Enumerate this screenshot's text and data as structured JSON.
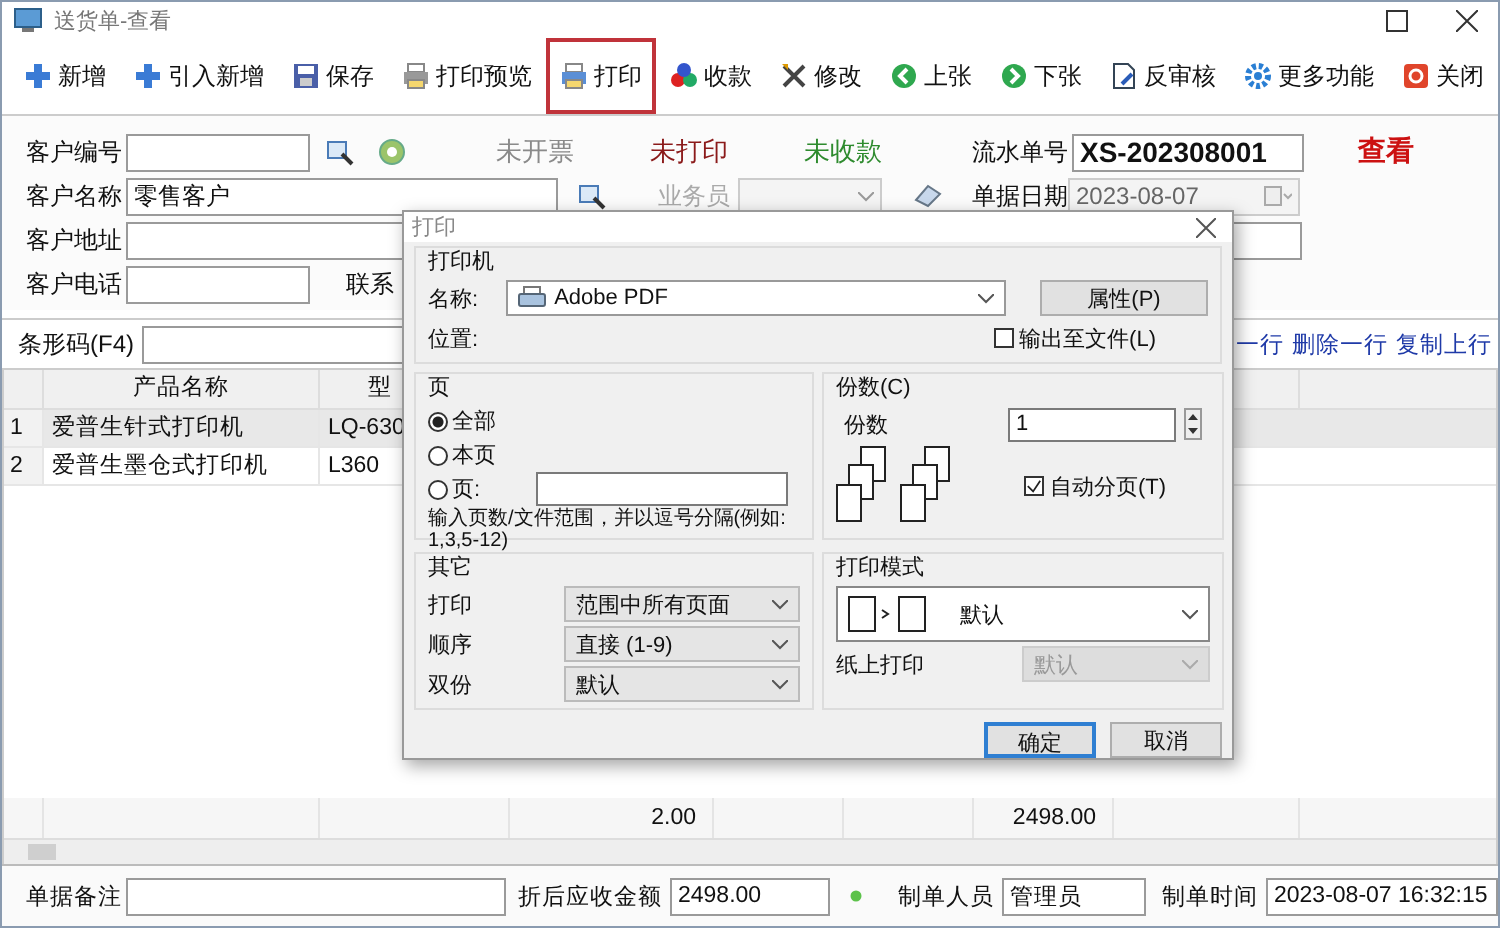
{
  "window": {
    "title": "送货单-查看"
  },
  "toolbar": [
    {
      "label": "新增",
      "selected": false
    },
    {
      "label": "引入新增",
      "selected": false
    },
    {
      "label": "保存",
      "selected": false
    },
    {
      "label": "打印预览",
      "selected": false
    },
    {
      "label": "打印",
      "selected": true
    },
    {
      "label": "收款",
      "selected": false
    },
    {
      "label": "修改",
      "selected": false
    },
    {
      "label": "上张",
      "selected": false
    },
    {
      "label": "下张",
      "selected": false
    },
    {
      "label": "反审核",
      "selected": false
    },
    {
      "label": "更多功能",
      "selected": false
    },
    {
      "label": "关闭",
      "selected": false
    }
  ],
  "form": {
    "customer_no": {
      "label": "客户编号"
    },
    "statuses": [
      {
        "text": "未开票",
        "color": "#8a8a8a"
      },
      {
        "text": "未打印",
        "color": "#8b1a1a"
      },
      {
        "text": "未收款",
        "color": "#2e8b2e"
      }
    ],
    "serial": {
      "label": "流水单号",
      "value": "XS-202308001"
    },
    "mode": "查看",
    "customer_name": {
      "label": "客户名称",
      "value": "零售客户"
    },
    "salesperson": {
      "label": "业务员",
      "disabled": true
    },
    "date": {
      "label": "单据日期",
      "value": "2023-08-07",
      "disabled": true
    },
    "address": {
      "label": "客户地址"
    },
    "phone": {
      "label": "客户电话"
    },
    "contact": {
      "label": "联系"
    }
  },
  "barcode": {
    "label": "条形码(F4)"
  },
  "row_actions": [
    "一行",
    "删除一行",
    "复制上行"
  ],
  "table": {
    "columns": [
      "产品名称",
      "型"
    ],
    "rows": [
      {
        "index": "1",
        "name": "爱普生针式打印机",
        "model": "LQ-630",
        "selected": true
      },
      {
        "index": "2",
        "name": "爱普生墨仓式打印机",
        "model": "L360",
        "selected": false
      }
    ],
    "totals": {
      "column_4": "2.00",
      "column_7": "2498.00"
    }
  },
  "footer": {
    "note": {
      "label": "单据备注"
    },
    "due": {
      "label": "折后应收金额",
      "value": "2498.00"
    },
    "maker": {
      "label": "制单人员",
      "value": "管理员"
    },
    "time": {
      "label": "制单时间",
      "value": "2023-08-07 16:32:15"
    }
  },
  "print_dialog": {
    "title": "打印",
    "printer": {
      "heading": "打印机",
      "name_label": "名称:",
      "name": "Adobe PDF",
      "properties_button": "属性(P)",
      "location_label": "位置:",
      "print_to_file": {
        "label": "输出至文件(L)",
        "checked": false
      }
    },
    "pages": {
      "heading": "页",
      "options": [
        {
          "label": "全部",
          "selected": true
        },
        {
          "label": "本页",
          "selected": false
        },
        {
          "label": "页:",
          "selected": false
        }
      ],
      "hint": "输入页数/文件范围，并以逗号分隔(例如: 1,3,5-12)"
    },
    "copies": {
      "heading": "份数(C)",
      "label": "份数",
      "value": "1",
      "collate": {
        "label": "自动分页(T)",
        "checked": true
      }
    },
    "other": {
      "heading": "其它",
      "settings": [
        {
          "label": "打印",
          "value": "范围中所有页面"
        },
        {
          "label": "顺序",
          "value": "直接 (1-9)"
        },
        {
          "label": "双份",
          "value": "默认"
        }
      ]
    },
    "print_mode": {
      "heading": "打印模式",
      "value": "默认",
      "paper_label": "纸上打印",
      "paper_value": "默认",
      "paper_disabled": true
    },
    "buttons": [
      {
        "label": "确定",
        "default": true
      },
      {
        "label": "取消",
        "default": false
      }
    ]
  }
}
